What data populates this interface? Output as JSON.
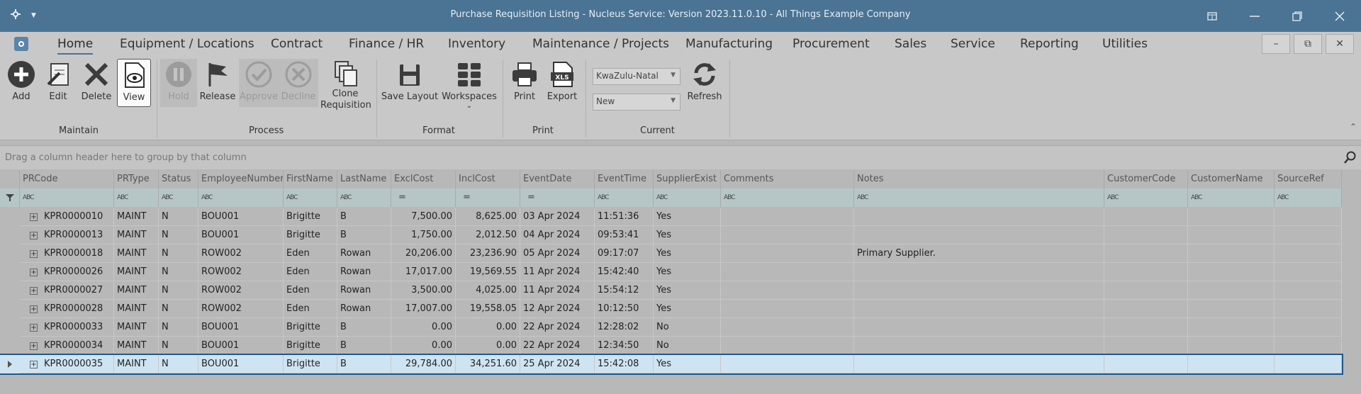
{
  "window": {
    "title": "Purchase Requisition Listing - Nucleus Service: Version 2023.11.0.10 - All Things Example Company"
  },
  "menu": {
    "tabs": [
      "Home",
      "Equipment / Locations",
      "Contract",
      "Finance / HR",
      "Inventory",
      "Maintenance / Projects",
      "Manufacturing",
      "Procurement",
      "Sales",
      "Service",
      "Reporting",
      "Utilities"
    ]
  },
  "ribbon": {
    "maintain": {
      "label": "Maintain",
      "add": "Add",
      "edit": "Edit",
      "delete": "Delete",
      "view": "View"
    },
    "process": {
      "label": "Process",
      "hold": "Hold",
      "release": "Release",
      "approve": "Approve",
      "decline": "Decline",
      "clone": "Clone Requisition"
    },
    "format": {
      "label": "Format",
      "save_layout": "Save Layout",
      "workspaces": "Workspaces"
    },
    "print": {
      "label": "Print",
      "print": "Print",
      "export": "Export"
    },
    "current": {
      "label": "Current",
      "region": "KwaZulu-Natal",
      "status": "New",
      "refresh": "Refresh"
    }
  },
  "grid": {
    "group_panel_text": "Drag a column header here to group by that column",
    "columns": [
      "PRCode",
      "PRType",
      "Status",
      "EmployeeNumber",
      "FirstName",
      "LastName",
      "ExclCost",
      "InclCost",
      "EventDate",
      "EventTime",
      "SupplierExist",
      "Comments",
      "Notes",
      "CustomerCode",
      "CustomerName",
      "SourceRef"
    ],
    "filter_text_icon": "ABC",
    "filter_eq_icon": "=",
    "rows": [
      [
        "KPR0000010",
        "MAINT",
        "N",
        "BOU001",
        "Brigitte",
        "B",
        "7,500.00",
        "8,625.00",
        "03 Apr 2024",
        "11:51:36",
        "Yes",
        "",
        "",
        "",
        "",
        ""
      ],
      [
        "KPR0000013",
        "MAINT",
        "N",
        "BOU001",
        "Brigitte",
        "B",
        "1,750.00",
        "2,012.50",
        "04 Apr 2024",
        "09:53:41",
        "Yes",
        "",
        "",
        "",
        "",
        ""
      ],
      [
        "KPR0000018",
        "MAINT",
        "N",
        "ROW002",
        "Eden",
        "Rowan",
        "20,206.00",
        "23,236.90",
        "05 Apr 2024",
        "09:17:07",
        "Yes",
        "",
        "Primary Supplier.",
        "",
        "",
        ""
      ],
      [
        "KPR0000026",
        "MAINT",
        "N",
        "ROW002",
        "Eden",
        "Rowan",
        "17,017.00",
        "19,569.55",
        "11 Apr 2024",
        "15:42:40",
        "Yes",
        "",
        "",
        "",
        "",
        ""
      ],
      [
        "KPR0000027",
        "MAINT",
        "N",
        "ROW002",
        "Eden",
        "Rowan",
        "3,500.00",
        "4,025.00",
        "11 Apr 2024",
        "15:54:12",
        "Yes",
        "",
        "",
        "",
        "",
        ""
      ],
      [
        "KPR0000028",
        "MAINT",
        "N",
        "ROW002",
        "Eden",
        "Rowan",
        "17,007.00",
        "19,558.05",
        "12 Apr 2024",
        "10:12:50",
        "Yes",
        "",
        "",
        "",
        "",
        ""
      ],
      [
        "KPR0000033",
        "MAINT",
        "N",
        "BOU001",
        "Brigitte",
        "B",
        "0.00",
        "0.00",
        "22 Apr 2024",
        "12:28:02",
        "No",
        "",
        "",
        "",
        "",
        ""
      ],
      [
        "KPR0000034",
        "MAINT",
        "N",
        "BOU001",
        "Brigitte",
        "B",
        "0.00",
        "0.00",
        "22 Apr 2024",
        "12:34:50",
        "No",
        "",
        "",
        "",
        "",
        ""
      ],
      [
        "KPR0000035",
        "MAINT",
        "N",
        "BOU001",
        "Brigitte",
        "B",
        "29,784.00",
        "34,251.60",
        "25 Apr 2024",
        "15:42:08",
        "Yes",
        "",
        "",
        "",
        "",
        ""
      ]
    ],
    "selected_row": 8
  },
  "colors": {
    "titlebar": "#4a7394",
    "selection": "#cfe4f2",
    "filter_row": "#b6c6c6"
  }
}
